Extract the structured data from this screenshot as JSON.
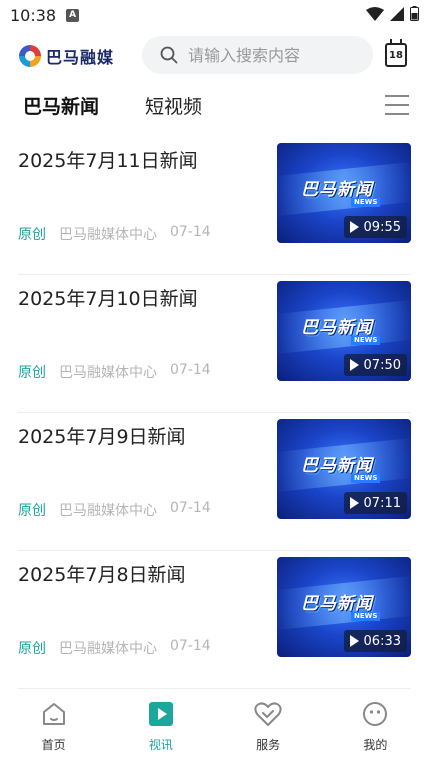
{
  "status_bar": {
    "time": "10:38",
    "notif_icon": "A"
  },
  "header": {
    "logo_text": "巴马融媒",
    "search_placeholder": "请输入搜索内容",
    "calendar_day": "18"
  },
  "tabs": {
    "active": "巴马新闻",
    "inactive": "短视频"
  },
  "news": [
    {
      "title": "2025年7月11日新闻",
      "tag": "原创",
      "source": "巴马融媒体中心",
      "date": "07-14",
      "thumb_logo": "巴马新闻",
      "thumb_badge": "NEWS",
      "duration": "09:55"
    },
    {
      "title": "2025年7月10日新闻",
      "tag": "原创",
      "source": "巴马融媒体中心",
      "date": "07-14",
      "thumb_logo": "巴马新闻",
      "thumb_badge": "NEWS",
      "duration": "07:50"
    },
    {
      "title": "2025年7月9日新闻",
      "tag": "原创",
      "source": "巴马融媒体中心",
      "date": "07-14",
      "thumb_logo": "巴马新闻",
      "thumb_badge": "NEWS",
      "duration": "07:11"
    },
    {
      "title": "2025年7月8日新闻",
      "tag": "原创",
      "source": "巴马融媒体中心",
      "date": "07-14",
      "thumb_logo": "巴马新闻",
      "thumb_badge": "NEWS",
      "duration": "06:33"
    }
  ],
  "bottom_nav": [
    {
      "label": "首页",
      "icon": "home-icon"
    },
    {
      "label": "视讯",
      "icon": "play-icon"
    },
    {
      "label": "服务",
      "icon": "heart-icon"
    },
    {
      "label": "我的",
      "icon": "smile-icon"
    }
  ],
  "colors": {
    "accent": "#1ba79b",
    "muted": "#b5b5b5"
  }
}
